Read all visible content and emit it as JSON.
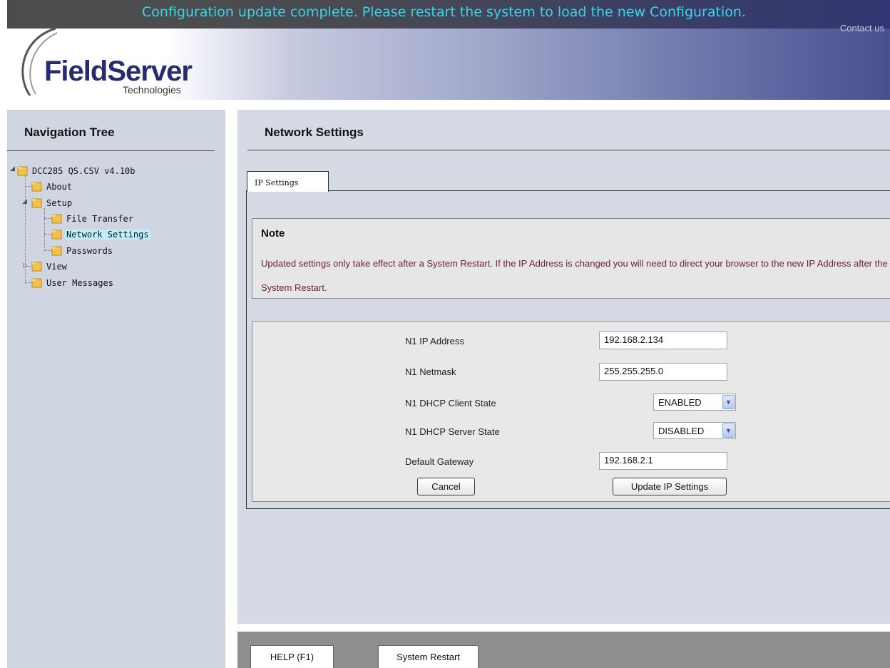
{
  "header": {
    "banner": "Configuration update complete. Please restart the system to load the new Configuration.",
    "contact_link": "Contact us",
    "logo_name": "FieldServer",
    "logo_sub": "Technologies"
  },
  "sidebar": {
    "title": "Navigation Tree",
    "tree": {
      "root": "DCC285 QS.CSV v4.10b",
      "about": "About",
      "setup": "Setup",
      "file_transfer": "File Transfer",
      "network_settings": "Network Settings",
      "passwords": "Passwords",
      "view": "View",
      "user_messages": "User Messages"
    },
    "selected": "Network Settings"
  },
  "main": {
    "title": "Network Settings",
    "tab_label": "IP Settings",
    "note": {
      "title": "Note",
      "text": "Updated settings only take effect after a System Restart. If the IP Address is changed you will need to direct your browser to the new IP Address after the System Restart."
    },
    "form": {
      "ip_label": "N1 IP Address",
      "ip_value": "192.168.2.134",
      "netmask_label": "N1 Netmask",
      "netmask_value": "255.255.255.0",
      "dhcp_client_label": "N1 DHCP Client State",
      "dhcp_client_value": "ENABLED",
      "dhcp_server_label": "N1 DHCP Server State",
      "dhcp_server_value": "DISABLED",
      "gateway_label": "Default Gateway",
      "gateway_value": "192.168.2.1",
      "cancel_label": "Cancel",
      "update_label": "Update IP Settings"
    }
  },
  "footer": {
    "help_label": "HELP (F1)",
    "restart_label": "System Restart"
  },
  "colors": {
    "banner_text": "#36d6e8",
    "note_text": "#6a1e3c",
    "selected_highlight": "#c1eefc",
    "sidebar_bg": "#cfd6e2",
    "main_bg": "#d5dae4"
  }
}
